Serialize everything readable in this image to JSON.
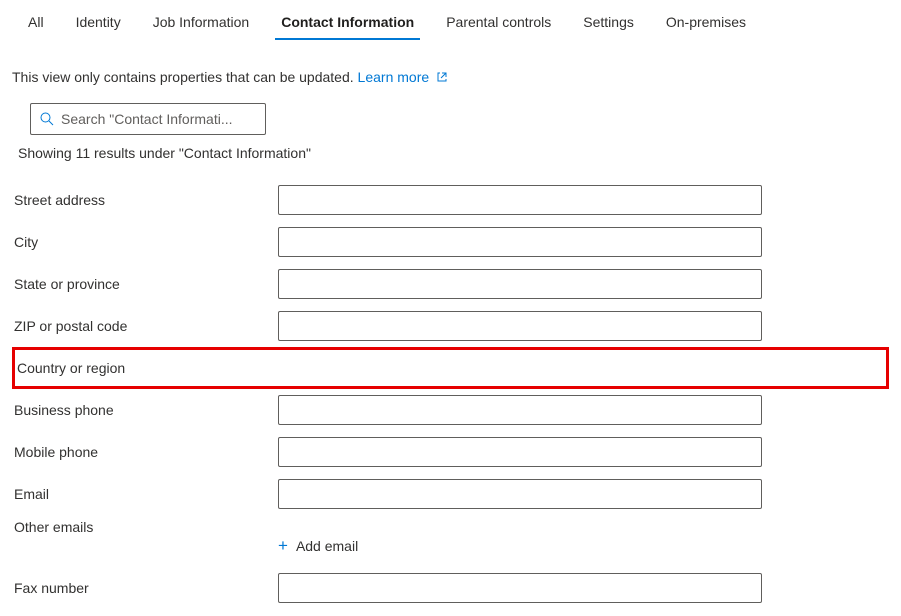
{
  "tabs": [
    {
      "label": "All",
      "active": false
    },
    {
      "label": "Identity",
      "active": false
    },
    {
      "label": "Job Information",
      "active": false
    },
    {
      "label": "Contact Information",
      "active": true
    },
    {
      "label": "Parental controls",
      "active": false
    },
    {
      "label": "Settings",
      "active": false
    },
    {
      "label": "On-premises",
      "active": false
    }
  ],
  "info_text": "This view only contains properties that can be updated.",
  "learn_more": "Learn more",
  "search_placeholder": "Search \"Contact Informati...",
  "results_text": "Showing 11 results under \"Contact Information\"",
  "fields": {
    "street_address": {
      "label": "Street address",
      "value": ""
    },
    "city": {
      "label": "City",
      "value": ""
    },
    "state": {
      "label": "State or province",
      "value": ""
    },
    "zip": {
      "label": "ZIP or postal code",
      "value": ""
    },
    "country": {
      "label": "Country or region",
      "value": ""
    },
    "business_phone": {
      "label": "Business phone",
      "value": ""
    },
    "mobile_phone": {
      "label": "Mobile phone",
      "value": ""
    },
    "email": {
      "label": "Email",
      "value": ""
    },
    "other_emails": {
      "label": "Other emails"
    },
    "fax": {
      "label": "Fax number",
      "value": ""
    }
  },
  "add_email_label": "Add email"
}
